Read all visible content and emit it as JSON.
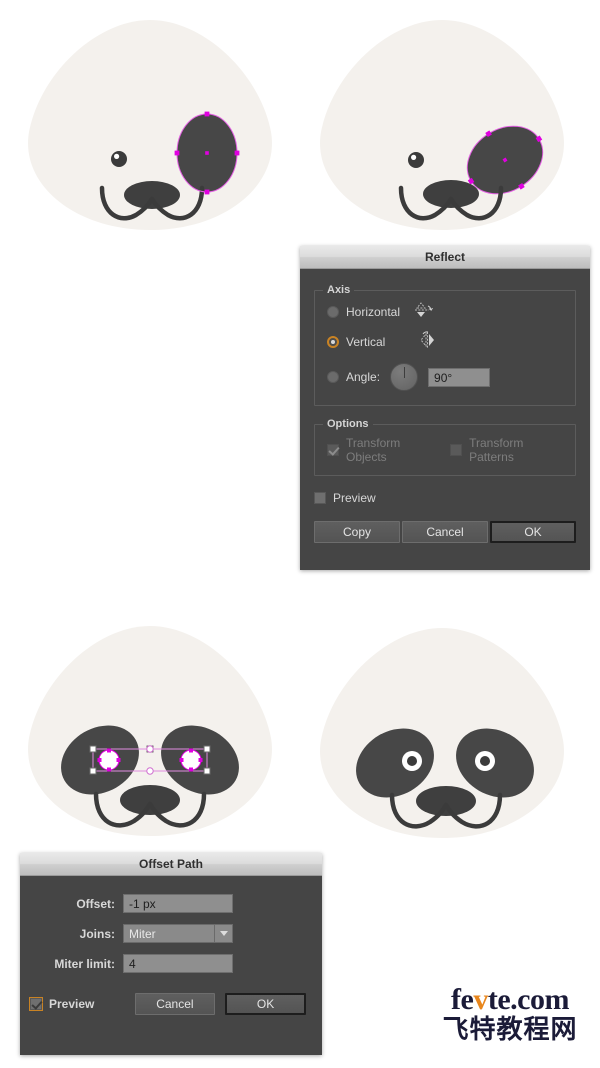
{
  "artwork": {
    "face_color": "#F4F1ED",
    "patch_color": "#474747",
    "eye_white": "#FFFFFF",
    "pupil_color": "#3B3B3B",
    "selection_color": "#E000E0",
    "selection_box_color": "#D878D8",
    "panels": [
      {
        "name": "panel-one-patch-selected",
        "caption": ""
      },
      {
        "name": "panel-patch-rotated-selected",
        "caption": ""
      },
      {
        "name": "panel-both-patches-eyes-selected",
        "caption": ""
      },
      {
        "name": "panel-final-panda",
        "caption": ""
      }
    ]
  },
  "reflect_dialog": {
    "title": "Reflect",
    "axis_group": {
      "legend": "Axis",
      "options": [
        {
          "label": "Horizontal",
          "selected": false,
          "icon": "reflect-horizontal-icon"
        },
        {
          "label": "Vertical",
          "selected": true,
          "icon": "reflect-vertical-icon"
        },
        {
          "label": "Angle:",
          "selected": false,
          "icon": "angle-dial-icon"
        }
      ],
      "angle_value": "90°"
    },
    "options_group": {
      "legend": "Options",
      "checkboxes": [
        {
          "label": "Transform Objects",
          "checked": true,
          "enabled": false
        },
        {
          "label": "Transform Patterns",
          "checked": false,
          "enabled": false
        }
      ]
    },
    "preview": {
      "label": "Preview",
      "checked": false
    },
    "buttons": [
      {
        "label": "Copy",
        "default": false
      },
      {
        "label": "Cancel",
        "default": false
      },
      {
        "label": "OK",
        "default": true
      }
    ]
  },
  "offset_path_dialog": {
    "title": "Offset Path",
    "fields": [
      {
        "label": "Offset:",
        "value": "-1 px",
        "type": "text"
      },
      {
        "label": "Joins:",
        "value": "Miter",
        "type": "select"
      },
      {
        "label": "Miter limit:",
        "value": "4",
        "type": "text"
      }
    ],
    "preview": {
      "label": "Preview",
      "checked": true
    },
    "buttons": [
      {
        "label": "Cancel",
        "default": false
      },
      {
        "label": "OK",
        "default": true
      }
    ]
  },
  "watermark": {
    "line1_a": "fe",
    "line1_v": "v",
    "line1_b": "te.com",
    "line2": "飞特教程网",
    "accent_color": "#E8861C",
    "text_color": "#1B1B38"
  }
}
